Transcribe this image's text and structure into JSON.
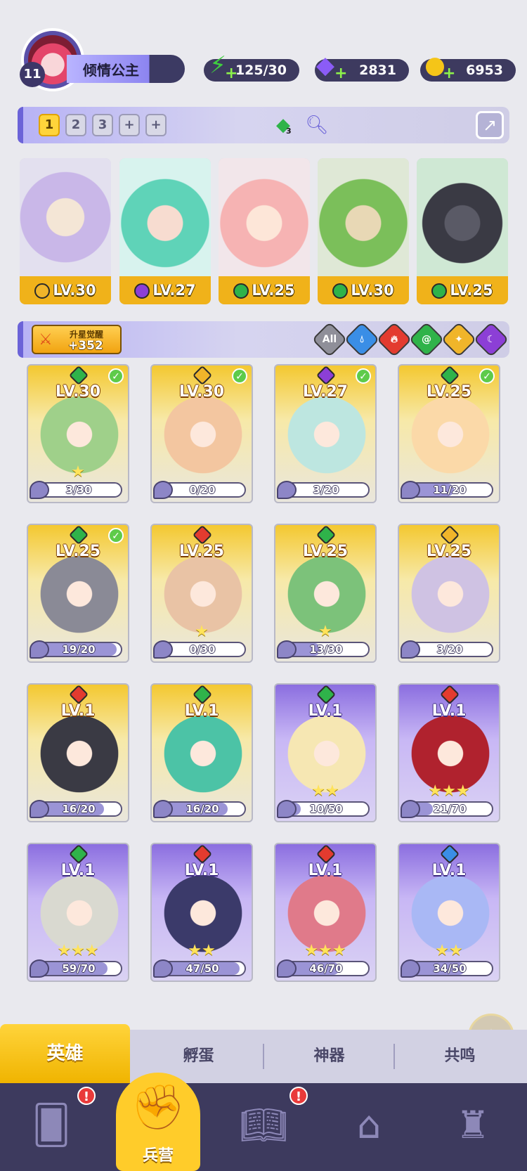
{
  "player": {
    "level": "11",
    "name": "倾情公主"
  },
  "resources": [
    {
      "name": "energy",
      "icon": "lightning-icon",
      "value": "125/30",
      "color": "#3fcf3f"
    },
    {
      "name": "gems",
      "icon": "diamond-icon",
      "value": "2831",
      "color": "#8b5cf6"
    },
    {
      "name": "coins",
      "icon": "coin-icon",
      "value": "6953",
      "color": "#f5c518"
    }
  ],
  "team_bar": {
    "slots": [
      "1",
      "2",
      "3",
      "+",
      "+"
    ],
    "active_slot": "1",
    "badge_count": "3"
  },
  "team": [
    {
      "element": "light",
      "level": "LV.30"
    },
    {
      "element": "dark",
      "level": "LV.27"
    },
    {
      "element": "nature",
      "level": "LV.25"
    },
    {
      "element": "nature",
      "level": "LV.30"
    },
    {
      "element": "nature",
      "level": "LV.25"
    }
  ],
  "awaken": {
    "label": "升星觉醒",
    "value": "+352"
  },
  "filters": [
    {
      "name": "all",
      "label": "All",
      "color": "#9a9a9a"
    },
    {
      "name": "water",
      "label": "",
      "color": "#3a8ee6"
    },
    {
      "name": "fire",
      "label": "",
      "color": "#e33b2f"
    },
    {
      "name": "nature",
      "label": "",
      "color": "#2fb34a"
    },
    {
      "name": "light",
      "label": "",
      "color": "#f0b52a"
    },
    {
      "name": "dark",
      "label": "",
      "color": "#8c3fd6"
    }
  ],
  "heroes": [
    {
      "level": "LV.30",
      "element": "nature",
      "rarity": "gold",
      "progress": "3/30",
      "checked": true,
      "stars": "★"
    },
    {
      "level": "LV.30",
      "element": "light",
      "rarity": "gold",
      "progress": "0/20",
      "checked": true,
      "stars": ""
    },
    {
      "level": "LV.27",
      "element": "dark",
      "rarity": "gold",
      "progress": "3/20",
      "checked": true,
      "stars": ""
    },
    {
      "level": "LV.25",
      "element": "nature",
      "rarity": "gold",
      "progress": "11/20",
      "checked": true,
      "stars": ""
    },
    {
      "level": "LV.25",
      "element": "nature",
      "rarity": "gold",
      "progress": "19/20",
      "checked": true,
      "stars": ""
    },
    {
      "level": "LV.25",
      "element": "fire",
      "rarity": "gold",
      "progress": "0/30",
      "checked": false,
      "stars": "★"
    },
    {
      "level": "LV.25",
      "element": "nature",
      "rarity": "gold",
      "progress": "13/30",
      "checked": false,
      "stars": "★"
    },
    {
      "level": "LV.25",
      "element": "light",
      "rarity": "gold",
      "progress": "3/20",
      "checked": false,
      "stars": ""
    },
    {
      "level": "LV.1",
      "element": "fire",
      "rarity": "gold",
      "progress": "16/20",
      "checked": false,
      "stars": ""
    },
    {
      "level": "LV.1",
      "element": "nature",
      "rarity": "gold",
      "progress": "16/20",
      "checked": false,
      "stars": ""
    },
    {
      "level": "LV.1",
      "element": "nature",
      "rarity": "purple",
      "progress": "10/50",
      "checked": false,
      "stars": "★★"
    },
    {
      "level": "LV.1",
      "element": "fire",
      "rarity": "purple",
      "progress": "21/70",
      "checked": false,
      "stars": "★★★"
    },
    {
      "level": "LV.1",
      "element": "nature",
      "rarity": "purple",
      "progress": "59/70",
      "checked": false,
      "stars": "★★★"
    },
    {
      "level": "LV.1",
      "element": "fire",
      "rarity": "purple",
      "progress": "47/50",
      "checked": false,
      "stars": "★★"
    },
    {
      "level": "LV.1",
      "element": "fire",
      "rarity": "purple",
      "progress": "46/70",
      "checked": false,
      "stars": "★★★"
    },
    {
      "level": "LV.1",
      "element": "water",
      "rarity": "purple",
      "progress": "34/50",
      "checked": false,
      "stars": "★★"
    }
  ],
  "tabs": [
    {
      "label": "英雄",
      "active": true
    },
    {
      "label": "孵蛋",
      "active": false
    },
    {
      "label": "神器",
      "active": false
    },
    {
      "label": "共鸣",
      "active": false
    }
  ],
  "nav": {
    "active_label": "兵营",
    "items": [
      "cards-icon",
      "barracks-icon",
      "map-book-icon",
      "temple-icon",
      "shrine-icon"
    ]
  },
  "element_colors": {
    "light": "#f0b52a",
    "dark": "#8c3fd6",
    "nature": "#2fb34a",
    "fire": "#e33b2f",
    "water": "#3a8ee6"
  }
}
